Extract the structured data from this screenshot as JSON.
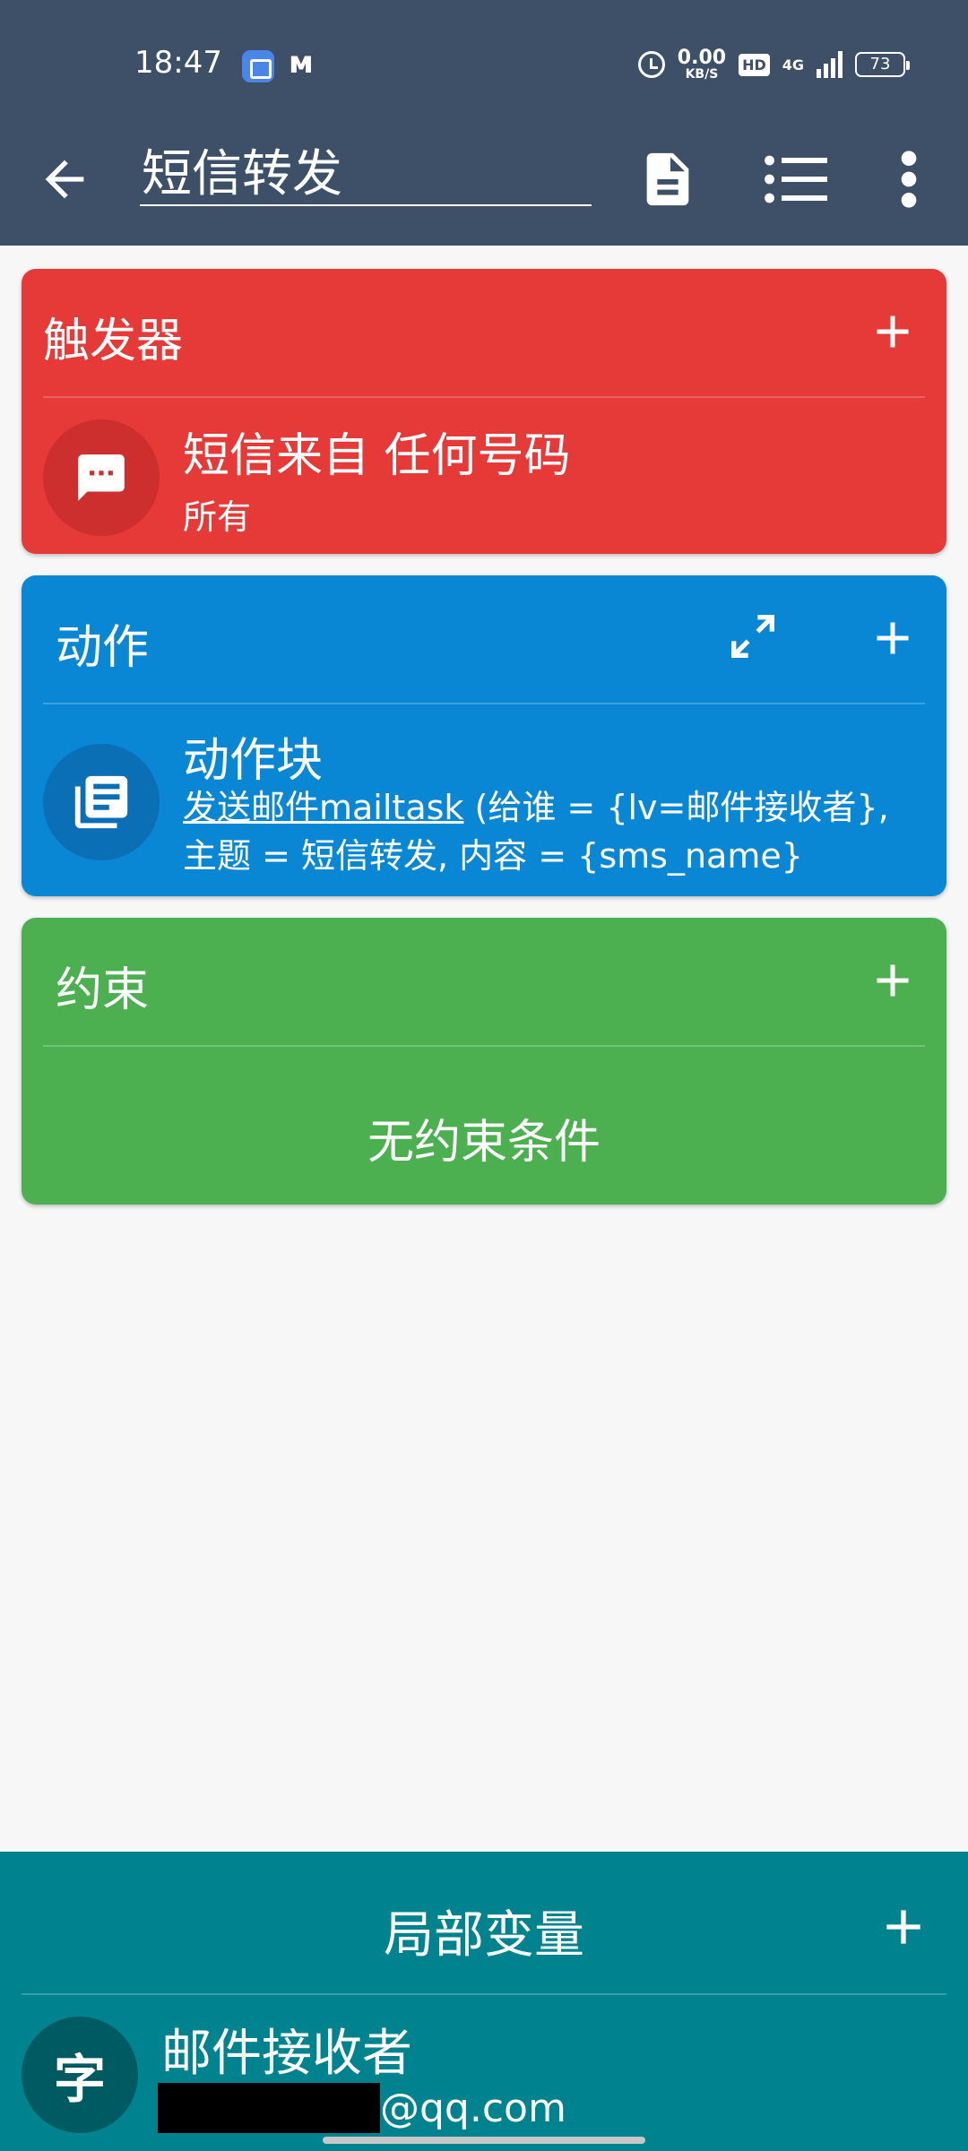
{
  "status_bar": {
    "time": "18:47",
    "app_icon_1": "task-app-icon",
    "app_icon_2": "ᴍ",
    "net_speed_value": "0.00",
    "net_speed_unit": "KB/S",
    "hd_label": "HD",
    "signal_label": "4G",
    "battery_level": "73"
  },
  "toolbar": {
    "title": "短信转发",
    "icons": [
      "back-arrow-icon",
      "document-icon",
      "list-icon",
      "more-vert-icon"
    ]
  },
  "triggers": {
    "header": "触发器",
    "item": {
      "icon": "message-icon",
      "title": "短信来自 任何号码",
      "subtitle": "所有"
    }
  },
  "actions": {
    "header": "动作",
    "item": {
      "icon": "action-block-icon",
      "title": "动作块",
      "link_text": "发送邮件mailtask",
      "detail_text": " (给谁 = {lv=邮件接收者}, 主题 = 短信转发, 内容 = {sms_name}"
    }
  },
  "constraints": {
    "header": "约束",
    "empty_text": "无约束条件"
  },
  "local_vars": {
    "header": "局部变量",
    "var": {
      "avatar_char": "字",
      "name": "邮件接收者",
      "value_suffix": "@qq.com"
    }
  },
  "colors": {
    "topbar": "#3e4f68",
    "trigger": "#e53a37",
    "action": "#0a87d4",
    "constraint": "#4cb050",
    "local_vars": "#00838f"
  }
}
